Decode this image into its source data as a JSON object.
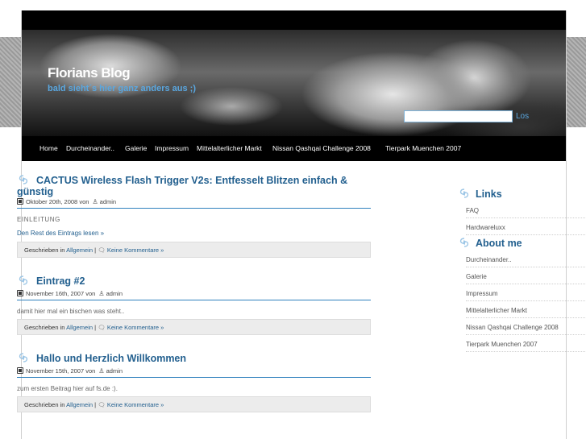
{
  "site": {
    "title": "Florians Blog",
    "subtitle": "bald sieht´s hier ganz anders aus ;)"
  },
  "search": {
    "value": "",
    "button_label": "Los"
  },
  "nav": {
    "items": [
      "Home",
      "Durcheinander..",
      "Galerie",
      "Impressum",
      "Mittelalterlicher Markt",
      "Nissan Qashqai Challenge 2008",
      "Tierpark Muenchen 2007"
    ]
  },
  "posts": [
    {
      "title": "CACTUS Wireless Flash Trigger V2s: Entfesselt Blitzen einfach & günstig",
      "date": "Oktober 20th, 2008",
      "by": "von",
      "author": "admin",
      "excerpt": "EINLEITUNG",
      "more": "Den Rest des Eintrags lesen »",
      "posted_in": "Geschrieben in",
      "category": "Allgemein",
      "sep": "|",
      "comments": "Keine Kommentare »"
    },
    {
      "title": "Eintrag #2",
      "date": "November 16th, 2007",
      "by": "von",
      "author": "admin",
      "excerpt": "damit hier mal ein bischen was steht..",
      "posted_in": "Geschrieben in",
      "category": "Allgemein",
      "sep": "|",
      "comments": "Keine Kommentare »"
    },
    {
      "title": "Hallo und Herzlich Willkommen",
      "date": "November 15th, 2007",
      "by": "von",
      "author": "admin",
      "excerpt": "zum ersten Beitrag hier auf fs.de :).",
      "posted_in": "Geschrieben in",
      "category": "Allgemein",
      "sep": "|",
      "comments": "Keine Kommentare »"
    }
  ],
  "sidebar": {
    "links_title": "Links",
    "links": [
      "FAQ",
      "Hardwareluxx"
    ],
    "about_title": "About me",
    "about": [
      "Durcheinander..",
      "Galerie",
      "Impressum",
      "Mittelalterlicher Markt",
      "Nissan Qashqai Challenge 2008",
      "Tierpark Muenchen 2007"
    ]
  },
  "colors": {
    "accent": "#23608f",
    "header_sub": "#5aa7e0",
    "nav_bg": "#000000",
    "rule": "#2f80bd"
  },
  "icons": {
    "title_icon": "swirl-icon",
    "date_icon": "calendar-icon",
    "author_icon": "person-icon",
    "comment_icon": "comment-bubble-icon"
  }
}
